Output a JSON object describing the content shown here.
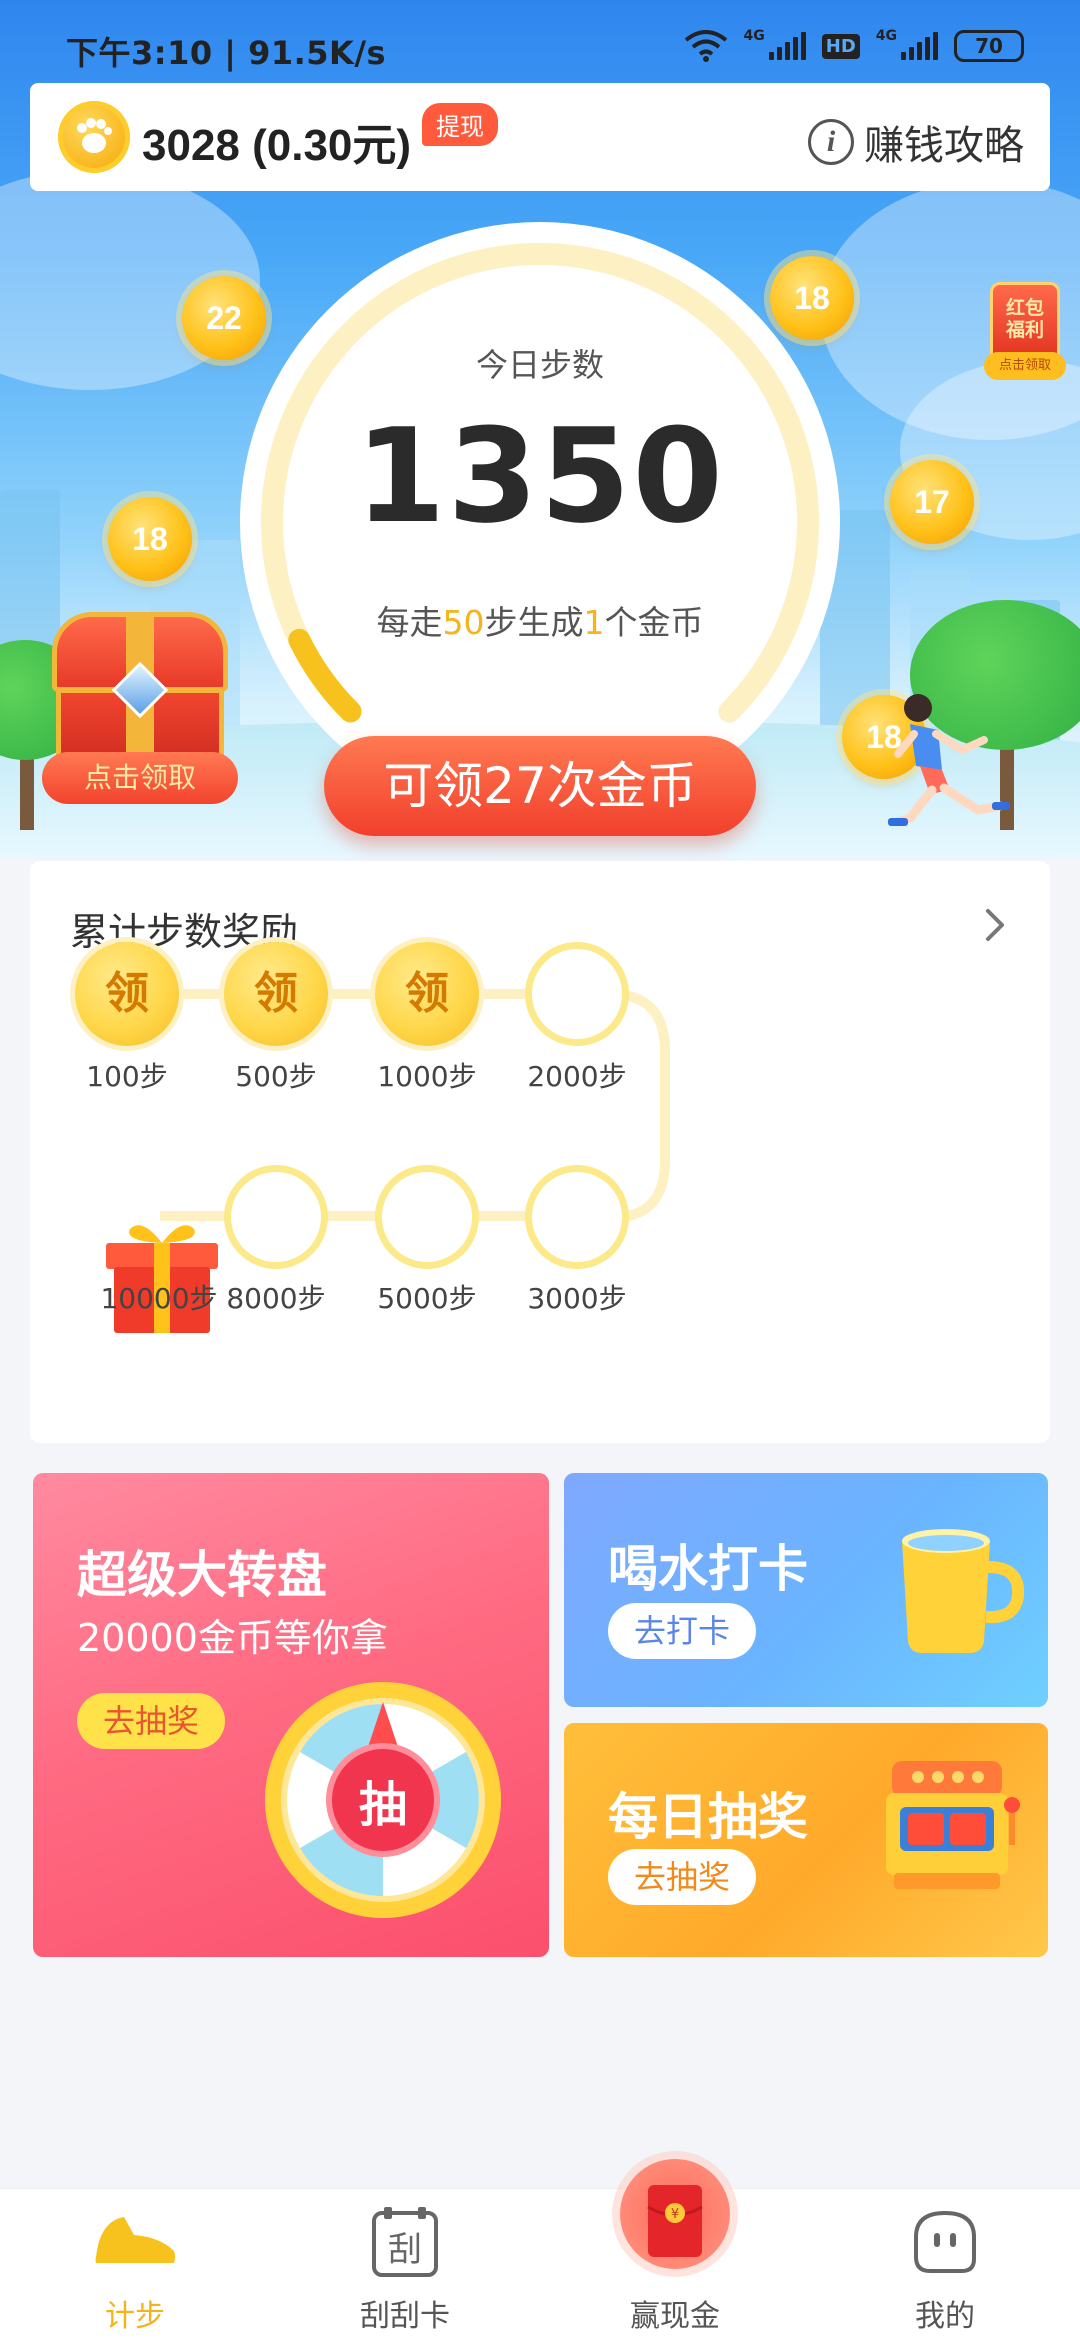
{
  "status_bar": {
    "time_speed": "下午3:10 | 91.5K/s",
    "network_1": "4G",
    "hd": "HD",
    "network_2": "4G",
    "battery": "70"
  },
  "header": {
    "coins": "3028 (0.30元)",
    "withdraw_label": "提现",
    "guide_label": "赚钱攻略"
  },
  "steps": {
    "today_label": "今日步数",
    "count": "1350",
    "rule_prefix": "每走",
    "rule_steps": "50",
    "rule_mid": "步生成",
    "rule_coins": "1",
    "rule_suffix": "个金币",
    "claim_label": "可领27次金币",
    "progress": 0.07
  },
  "floating_coins": [
    "22",
    "18",
    "18",
    "17",
    "18"
  ],
  "chest": {
    "label": "点击领取"
  },
  "red_packet": {
    "line1": "红包",
    "line2": "福利",
    "tag": "点击领取"
  },
  "cumulative": {
    "title": "累计步数奖励",
    "claim_char": "领",
    "milestones": [
      {
        "label": "100步",
        "state": "claimable"
      },
      {
        "label": "500步",
        "state": "claimable"
      },
      {
        "label": "1000步",
        "state": "claimable"
      },
      {
        "label": "2000步",
        "state": "empty"
      },
      {
        "label": "3000步",
        "state": "empty"
      },
      {
        "label": "5000步",
        "state": "empty"
      },
      {
        "label": "8000步",
        "state": "empty"
      },
      {
        "label": "10000步",
        "state": "gift"
      }
    ]
  },
  "features": {
    "wheel": {
      "title": "超级大转盘",
      "subtitle": "20000金币等你拿",
      "button": "去抽奖",
      "center": "抽"
    },
    "water": {
      "title": "喝水打卡",
      "button": "去打卡"
    },
    "lottery": {
      "title": "每日抽奖",
      "button": "去抽奖"
    }
  },
  "tabs": [
    {
      "label": "计步",
      "active": true
    },
    {
      "label": "刮刮卡",
      "active": false
    },
    {
      "label": "赢现金",
      "active": false
    },
    {
      "label": "我的",
      "active": false
    }
  ],
  "colors": {
    "accent_yellow": "#f6b319",
    "claim_red": "#f23f2c",
    "hero_blue": "#2f86ee"
  }
}
